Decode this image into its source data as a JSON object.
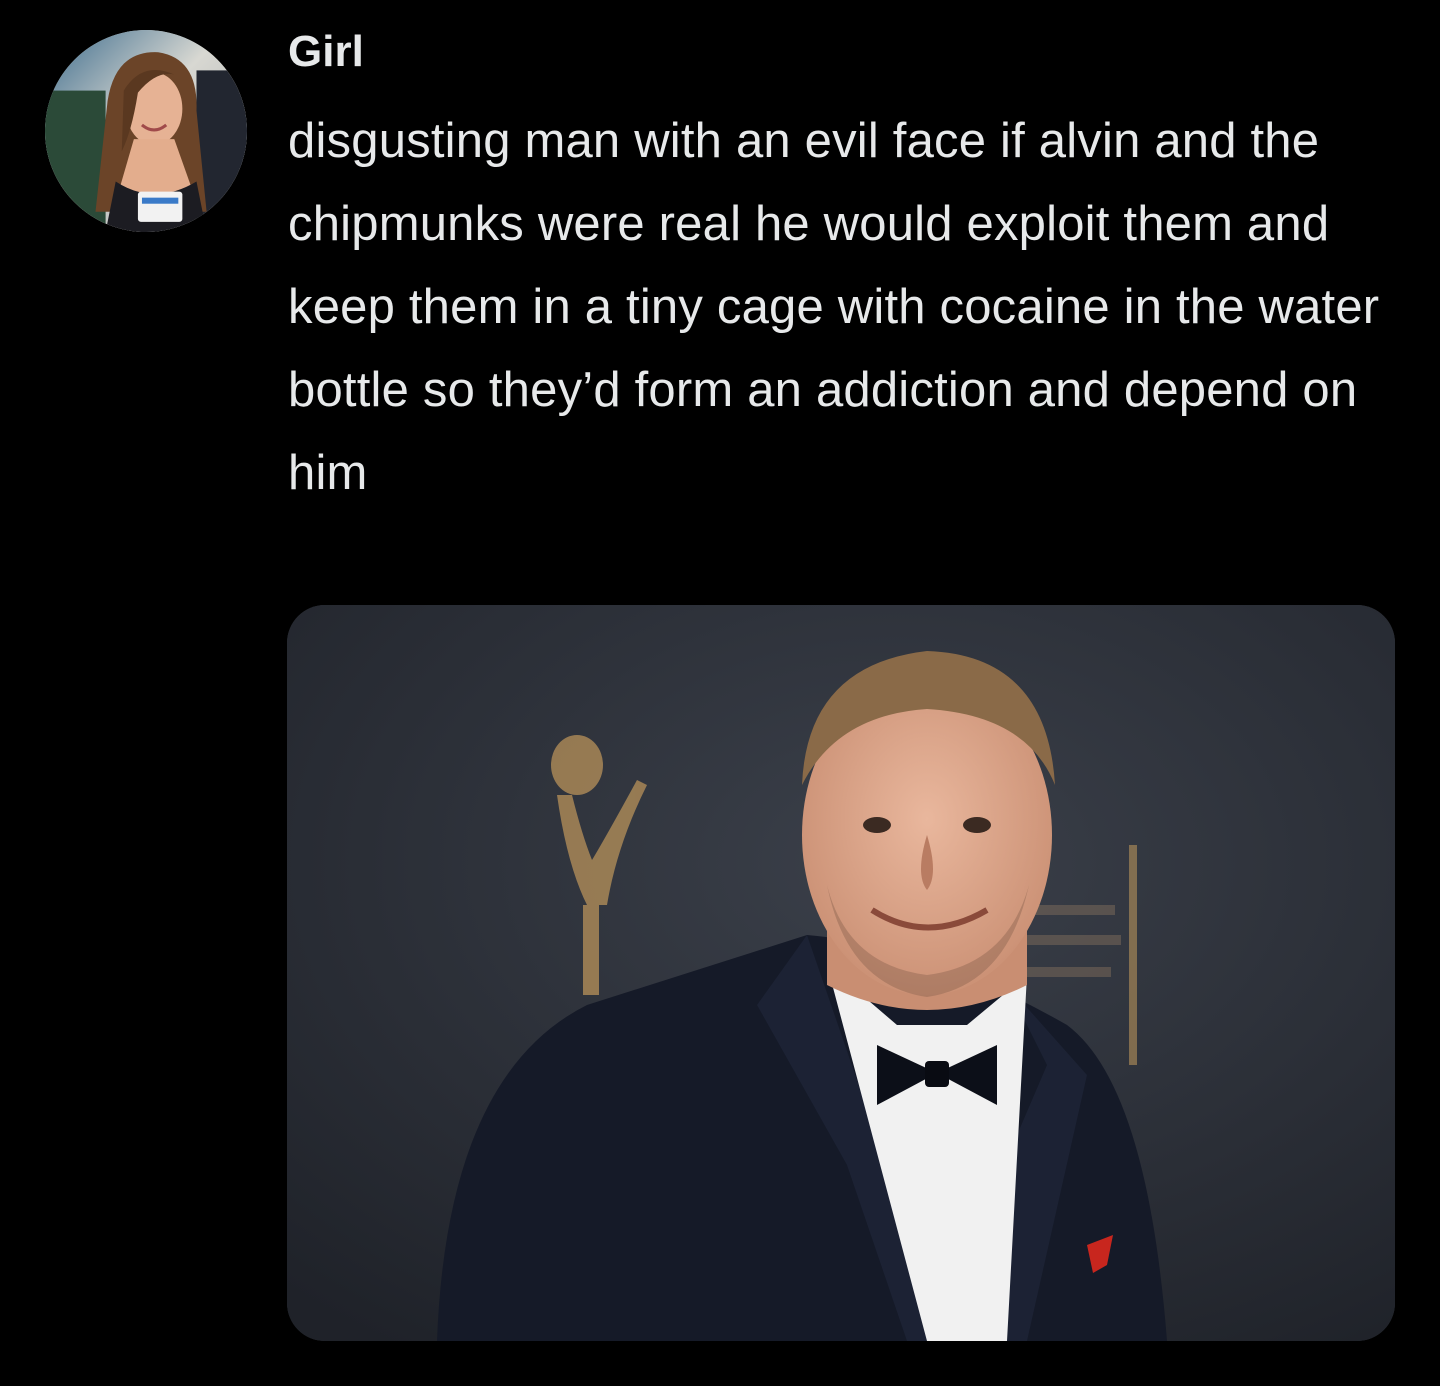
{
  "tweet": {
    "author": {
      "display_name": "Girl",
      "avatar_icon": "profile-photo-avatar"
    },
    "text": "disgusting man with an evil face if alvin and the chipmunks were real he would exploit them and keep them in a tiny cage with cocaine in the water bottle so they’d form an addiction and depend on him",
    "media": {
      "type": "photo",
      "subject": "man-in-tuxedo-photo"
    }
  },
  "colors": {
    "background": "#000000",
    "text": "#e7e9ea",
    "photo_backdrop": "#2c3038",
    "emmy_gold": "#b8925a"
  }
}
